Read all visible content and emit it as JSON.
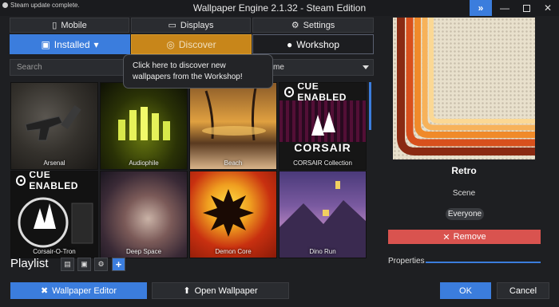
{
  "titlebar": {
    "status_text": "Steam update complete.",
    "title": "Wallpaper Engine 2.1.32 - Steam Edition",
    "ext_icon": "double-chevron-icon"
  },
  "top_tabs": [
    {
      "label": "Mobile",
      "icon": "mobile-icon"
    },
    {
      "label": "Displays",
      "icon": "monitor-icon"
    },
    {
      "label": "Settings",
      "icon": "gear-icon"
    }
  ],
  "main_tabs": [
    {
      "label": "Installed",
      "icon": "save-icon",
      "active": true
    },
    {
      "label": "Discover",
      "icon": "compass-icon"
    },
    {
      "label": "Workshop",
      "icon": "steam-icon"
    }
  ],
  "search": {
    "placeholder": "Search"
  },
  "sort": {
    "value": "me"
  },
  "tooltip": {
    "text": "Click here to discover new wallpapers from the Workshop!"
  },
  "wallpapers": [
    {
      "name": "Arsenal"
    },
    {
      "name": "Audiophile"
    },
    {
      "name": "Beach"
    },
    {
      "name": "CORSAIR Collection",
      "badge": "CUE ENABLED",
      "brand": "CORSAIR"
    },
    {
      "name": "Corsair-O-Tron",
      "badge": "CUE ENABLED"
    },
    {
      "name": "Deep Space"
    },
    {
      "name": "Demon Core"
    },
    {
      "name": "Dino Run"
    }
  ],
  "playlist": {
    "label": "Playlist",
    "add_label": "+"
  },
  "bottom": {
    "editor_label": "Wallpaper Editor",
    "open_label": "Open Wallpaper",
    "ok_label": "OK",
    "cancel_label": "Cancel"
  },
  "detail": {
    "title": "Retro",
    "type": "Scene",
    "rating": "Everyone",
    "remove_label": "Remove",
    "properties_label": "Properties"
  },
  "colors": {
    "accent": "#3b7ddd",
    "discover": "#c8861a",
    "remove": "#d9534f"
  }
}
